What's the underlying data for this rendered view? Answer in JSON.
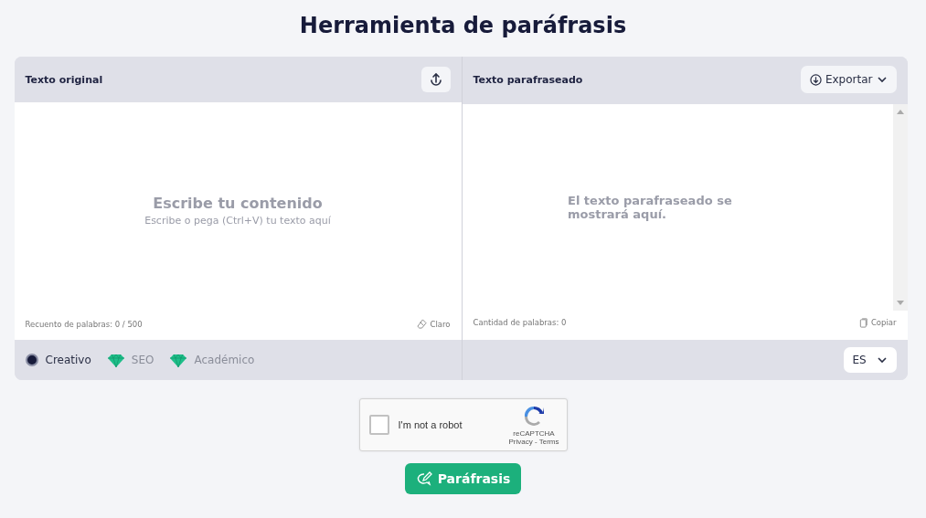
{
  "title": "Herramienta de paráfrasis",
  "input_panel": {
    "title": "Texto original",
    "placeholder_heading": "Escribe tu contenido",
    "placeholder": "Escribe o pega (Ctrl+V) tu texto aquí",
    "word_count": "Recuento de palabras: 0 / 500",
    "clear_label": "Claro",
    "modes": [
      {
        "label": "Creativo",
        "kind": "radio",
        "selected": true
      },
      {
        "label": "SEO",
        "kind": "premium",
        "selected": false
      },
      {
        "label": "Académico",
        "kind": "premium",
        "selected": false
      }
    ]
  },
  "output_panel": {
    "title": "Texto parafraseado",
    "export_label": "Exportar",
    "placeholder": "El texto parafraseado se mostrará aquí.",
    "word_count": "Cantidad de palabras: 0",
    "copy_label": "Copiar",
    "language": "ES"
  },
  "captcha": {
    "label": "I'm not a robot",
    "checked": false,
    "brand": "reCAPTCHA",
    "links": "Privacy - Terms"
  },
  "submit_label": "Paráfrasis"
}
